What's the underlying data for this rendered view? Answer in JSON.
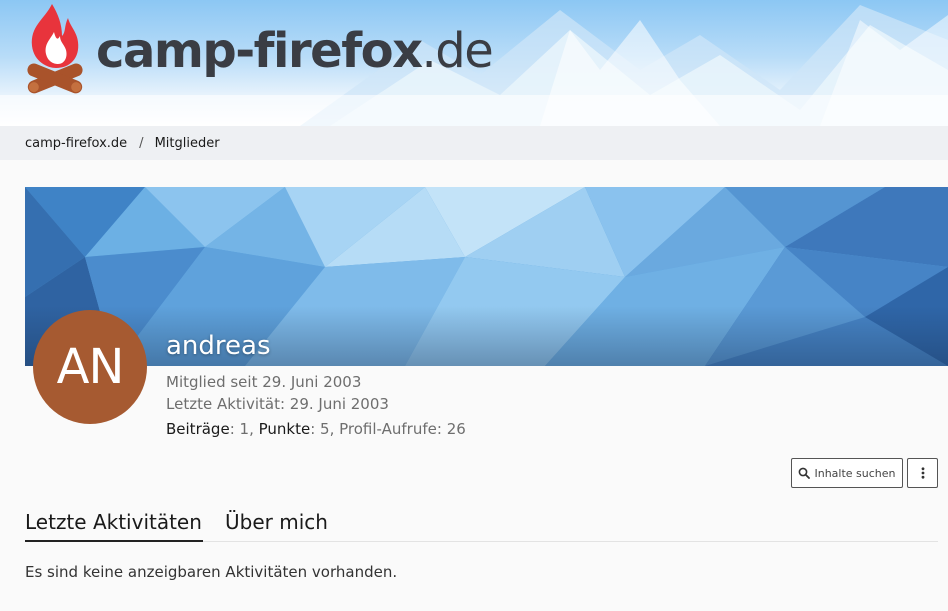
{
  "colors": {
    "header_sky": "#8cc7f4",
    "flame": "#e8343c",
    "logs": "#a9532b",
    "avatar_bg": "#a65a31",
    "breadcrumb_bg": "#eef0f3",
    "page_bg": "#fafafa"
  },
  "header": {
    "logo_bold": "camp-firefox",
    "logo_light": ".de",
    "logo_icon": "campfire-icon"
  },
  "breadcrumb": {
    "items": [
      "camp-firefox.de",
      "Mitglieder"
    ],
    "separator": "/"
  },
  "profile": {
    "avatar_initials": "AN",
    "username": "andreas",
    "member_since": "Mitglied seit 29. Juni 2003",
    "last_activity": "Letzte Aktivität: 29. Juni 2003",
    "stats": {
      "posts_label": "Beiträge",
      "posts_value": "1",
      "points_label": "Punkte",
      "points_value": "5",
      "views_label": "Profil-Aufrufe",
      "views_value": "26"
    }
  },
  "actions": {
    "search_label": "Inhalte suchen",
    "search_icon": "search-icon",
    "more_icon": "more-vertical-icon"
  },
  "tabs": [
    {
      "label": "Letzte Aktivitäten",
      "active": true
    },
    {
      "label": "Über mich",
      "active": false
    }
  ],
  "content": {
    "empty_message": "Es sind keine anzeigbaren Aktivitäten vorhanden."
  }
}
